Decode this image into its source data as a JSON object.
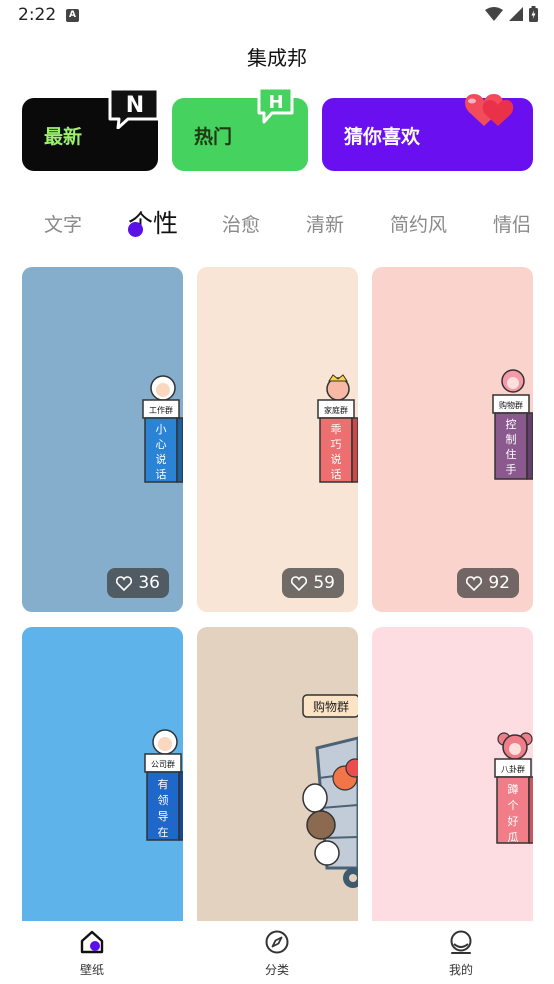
{
  "status_bar": {
    "time": "2:22",
    "notification_icon": "a-letter-icon"
  },
  "app_title": "集成邦",
  "category_cards": [
    {
      "label": "最新",
      "badge": "N",
      "color": "#0a0a0a",
      "label_color": "#9df06e"
    },
    {
      "label": "热门",
      "badge": "H",
      "color": "#45d25e",
      "label_color": "#1f3a12"
    },
    {
      "label": "猜你喜欢",
      "badge": "heart-icon",
      "color": "#6a0ff0",
      "label_color": "#ffffff"
    }
  ],
  "tabs": [
    {
      "label": "文字"
    },
    {
      "label": "个性",
      "active": true
    },
    {
      "label": "治愈"
    },
    {
      "label": "清新"
    },
    {
      "label": "简约风"
    },
    {
      "label": "情侣"
    }
  ],
  "wallpapers": [
    {
      "bg": "#84aecb",
      "likes": "36",
      "sign_top": "工作群",
      "sign_text": "小心说话",
      "sign_color": "#2b83d6"
    },
    {
      "bg": "#f8e5d6",
      "likes": "59",
      "sign_top": "家庭群",
      "sign_text": "乖巧说话",
      "sign_color": "#ee6f70"
    },
    {
      "bg": "#fad4cc",
      "likes": "92",
      "sign_top": "购物群",
      "sign_text": "控制住手",
      "sign_color": "#8a5a8f"
    },
    {
      "bg": "#5db3ea",
      "sign_top": "公司群",
      "sign_text": "有领导在",
      "sign_color": "#1f67c8"
    },
    {
      "bg": "#e4d2c0",
      "sign_top": "购物群",
      "sign_text": "",
      "sign_color": "#f5c89a"
    },
    {
      "bg": "#fddde1",
      "sign_top": "八卦群",
      "sign_text": "蹲个好瓜",
      "sign_color": "#f17d89"
    }
  ],
  "bottom_nav": [
    {
      "label": "壁纸",
      "icon": "home-icon",
      "active": true
    },
    {
      "label": "分类",
      "icon": "compass-icon"
    },
    {
      "label": "我的",
      "icon": "profile-icon"
    }
  ],
  "accent_color": "#5b10e8"
}
